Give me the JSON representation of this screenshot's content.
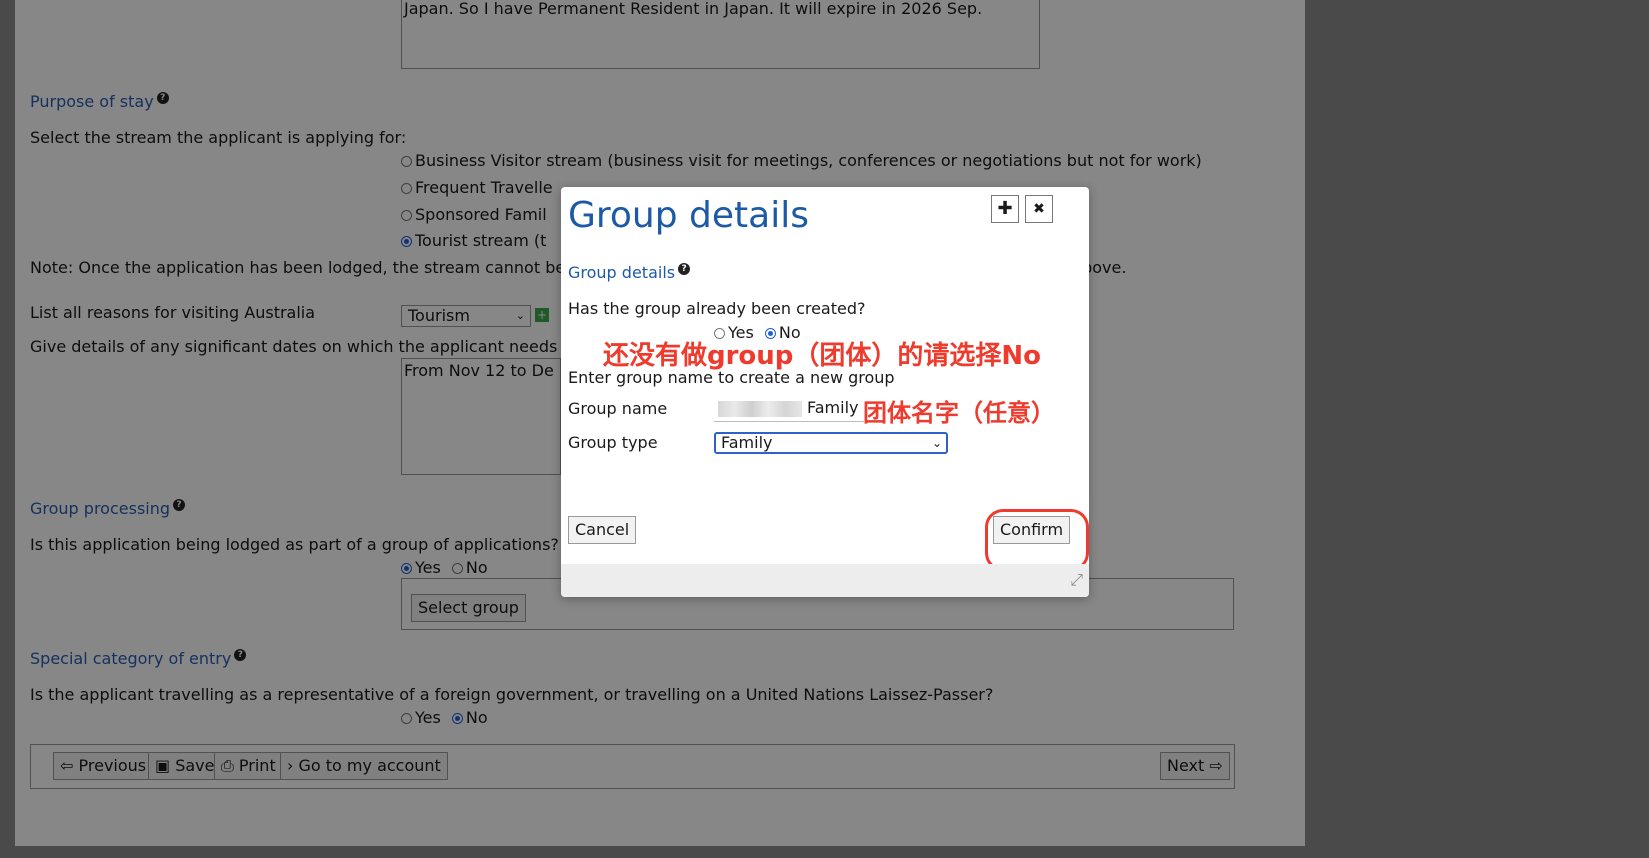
{
  "page": {
    "travel_history_text": "Japan. So I have Permanent Resident in Japan. It will expire in 2026 Sep.",
    "purpose_title": "Purpose of stay",
    "stream_prompt": "Select the stream the applicant is applying for:",
    "streams": [
      "Business Visitor stream (business visit for meetings, conferences or negotiations but not for work)",
      "Frequent Travelle",
      "Sponsored Famil",
      "Tourist stream (t"
    ],
    "stream_note_left": "Note: Once the application has been lodged, the stream cannot be",
    "stream_note_right": "icon above.",
    "reasons_label": "List all reasons for visiting Australia",
    "reasons_value": "Tourism",
    "dates_label": "Give details of any significant dates on which the applicant needs t",
    "dates_text": "From Nov 12 to De",
    "group_processing_title": "Group processing",
    "group_question": "Is this application being lodged as part of a group of applications?",
    "yes_label": "Yes",
    "no_label": "No",
    "select_group_label": "Select group",
    "special_title": "Special category of entry",
    "special_question": "Is the applicant travelling as a representative of a foreign government, or travelling on a United Nations Laissez-Passer?",
    "nav": {
      "previous": "Previous",
      "save": "Save",
      "print": "Print",
      "account": "Go to my account",
      "next": "Next"
    }
  },
  "modal": {
    "title": "Group details",
    "section_title": "Group details",
    "created_question": "Has the group already been created?",
    "yes_label": "Yes",
    "no_label": "No",
    "annotation_no": "还没有做group（团体）的请选择No",
    "create_prompt": "Enter group name to create a new group",
    "name_label": "Group name",
    "name_value": "Family",
    "annotation_name": "团体名字（任意）",
    "type_label": "Group type",
    "type_value": "Family",
    "cancel_label": "Cancel",
    "confirm_label": "Confirm",
    "max_icon_glyph": "✚",
    "close_icon_glyph": "✖",
    "resize_icon_glyph": "⤢"
  }
}
